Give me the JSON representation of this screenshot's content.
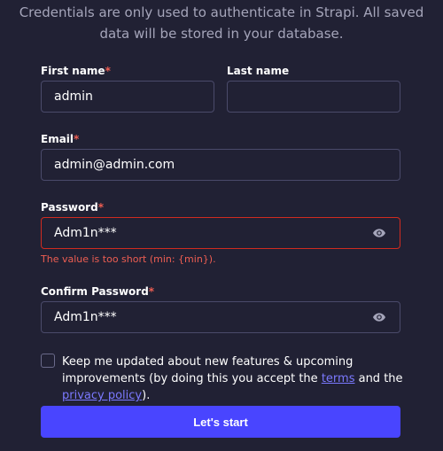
{
  "subtitle": {
    "line1": "Credentials are only used to authenticate in Strapi. All saved",
    "line2": "data will be stored in your database."
  },
  "form": {
    "first_name": {
      "label": "First name",
      "required": "*",
      "value": "admin"
    },
    "last_name": {
      "label": "Last name",
      "value": ""
    },
    "email": {
      "label": "Email",
      "required": "*",
      "value": "admin@admin.com"
    },
    "password": {
      "label": "Password",
      "required": "*",
      "value": "Adm1n***",
      "error": "The value is too short (min: {min})."
    },
    "confirm_password": {
      "label": "Confirm Password",
      "required": "*",
      "value": "Adm1n***"
    },
    "newsletter": {
      "text_before": "Keep me updated about new features & upcoming improvements (by doing this you accept the ",
      "terms_link": "terms",
      "text_middle": " and the ",
      "privacy_link": "privacy policy",
      "text_after": ").",
      "checked": false
    },
    "submit_label": "Let's start"
  },
  "icons": {
    "password_toggle": "eye-icon"
  },
  "colors": {
    "background": "#212134",
    "accent": "#4945ff",
    "error": "#ee5e52",
    "link": "#7b79ff"
  }
}
